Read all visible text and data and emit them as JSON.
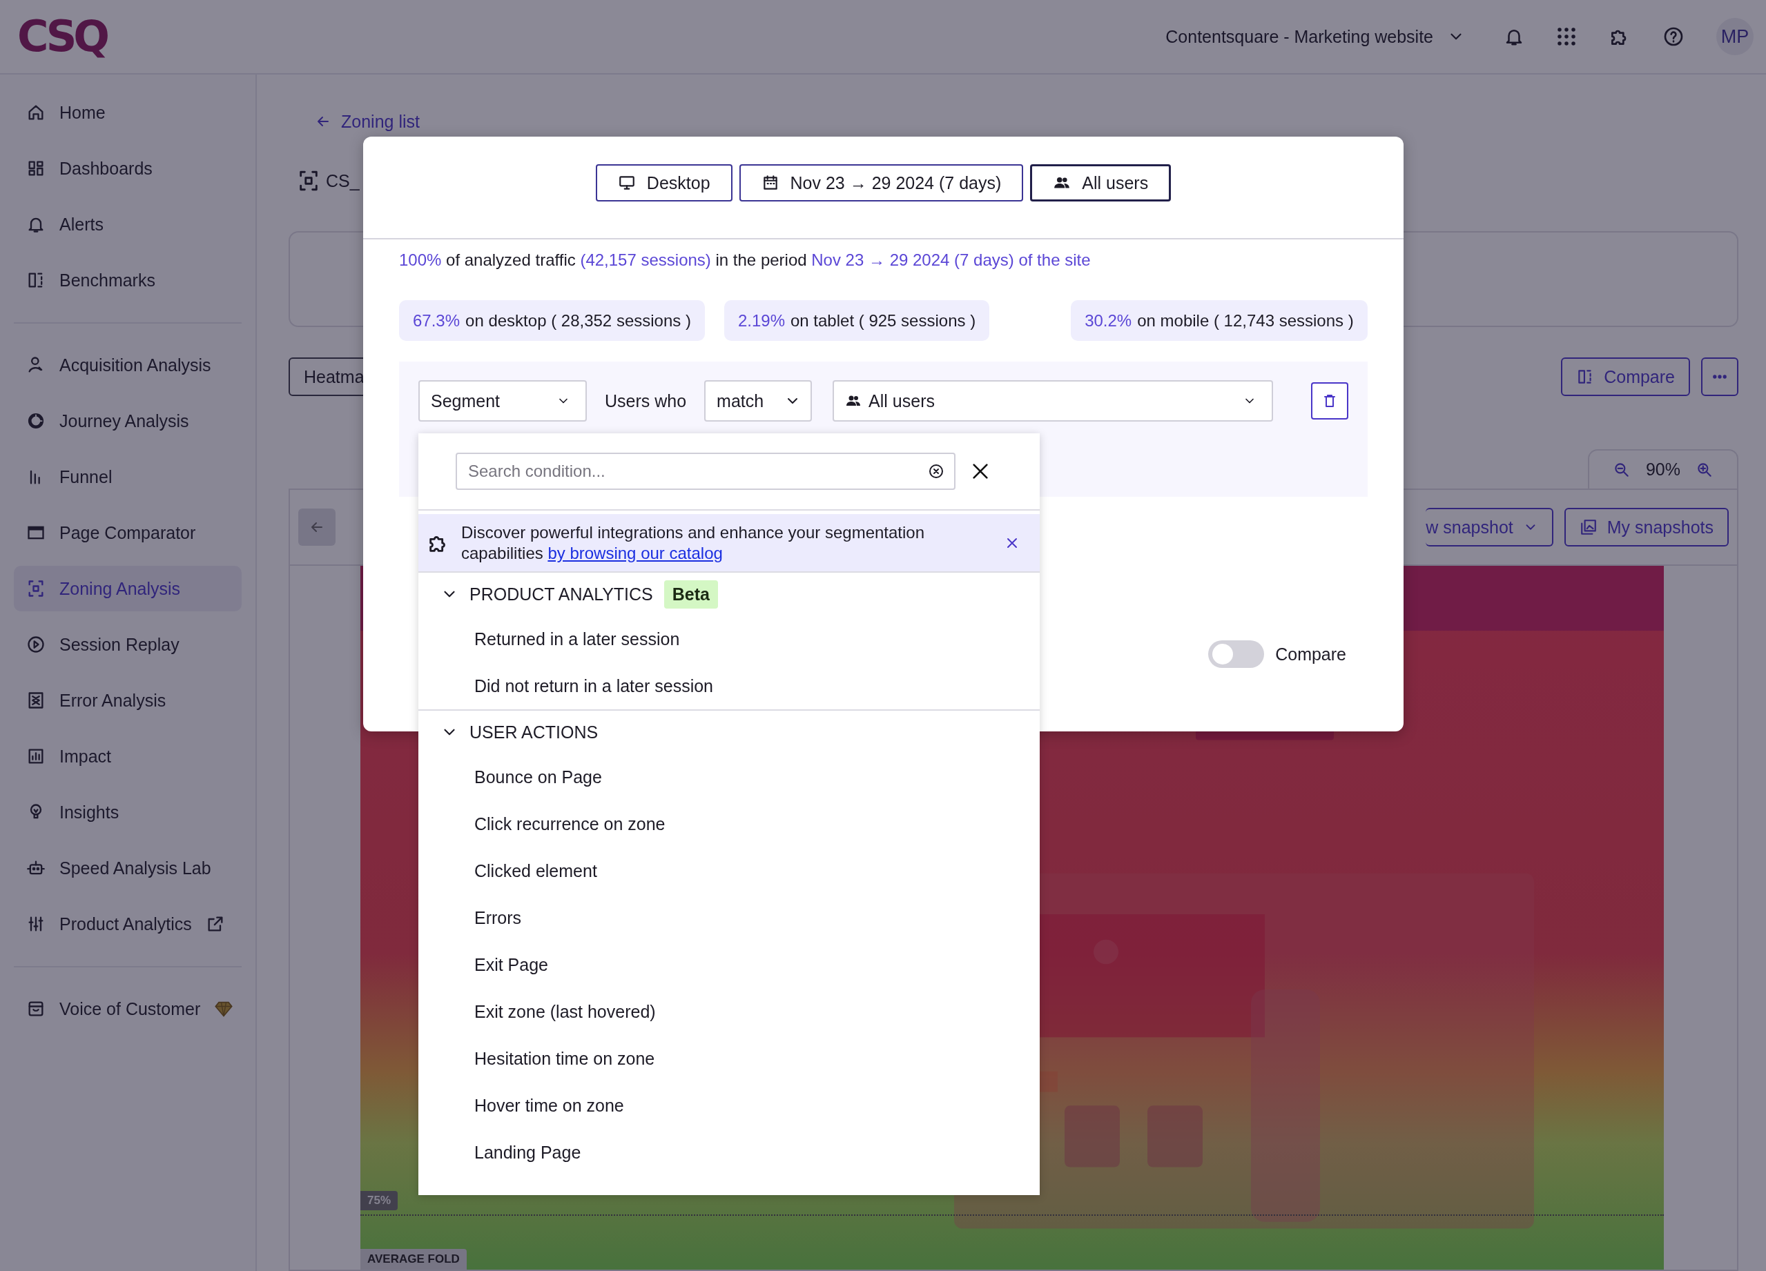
{
  "header": {
    "logo": "CSQ",
    "project": "Contentsquare - Marketing website",
    "avatar": "MP"
  },
  "sidebar": {
    "groups": [
      {
        "items": [
          {
            "label": "Home",
            "selected": false
          },
          {
            "label": "Dashboards",
            "selected": false
          },
          {
            "label": "Alerts",
            "selected": false
          },
          {
            "label": "Benchmarks",
            "selected": false
          }
        ]
      },
      {
        "items": [
          {
            "label": "Acquisition Analysis",
            "selected": false
          },
          {
            "label": "Journey Analysis",
            "selected": false
          },
          {
            "label": "Funnel",
            "selected": false
          },
          {
            "label": "Page Comparator",
            "selected": false
          },
          {
            "label": "Zoning Analysis",
            "selected": true
          },
          {
            "label": "Session Replay",
            "selected": false
          },
          {
            "label": "Error Analysis",
            "selected": false
          },
          {
            "label": "Impact",
            "selected": false
          },
          {
            "label": "Insights",
            "selected": false
          },
          {
            "label": "Speed Analysis Lab",
            "selected": false
          },
          {
            "label": "Product Analytics",
            "selected": false
          }
        ]
      },
      {
        "items": [
          {
            "label": "Voice of Customer",
            "selected": false
          }
        ]
      }
    ]
  },
  "main": {
    "back_link": "Zoning list",
    "title": "CS_",
    "view_button": "Heatma",
    "compare_button": "Compare",
    "zoom": "90%",
    "snapshot_dropdown": "w snapshot",
    "snapshots_button": "My snapshots",
    "fold_percent": "75%",
    "fold_label": "AVERAGE FOLD"
  },
  "modal": {
    "filters": [
      "Desktop",
      "Nov 23 → 29 2024 (7 days)",
      "All users"
    ],
    "summary": [
      {
        "text": "100%",
        "highlight": true
      },
      {
        "text": " of analyzed traffic ",
        "highlight": false
      },
      {
        "text": "(42,157 sessions)",
        "highlight": true
      },
      {
        "text": " in the period ",
        "highlight": false
      },
      {
        "text": "Nov 23 → 29 2024 (7 days) of the site",
        "highlight": true
      }
    ],
    "stats": [
      {
        "percent": "67.3%",
        "label": "on desktop ( 28,352 sessions )"
      },
      {
        "percent": "2.19%",
        "label": "on tablet ( 925 sessions )"
      },
      {
        "percent": "30.2%",
        "label": "on mobile ( 12,743 sessions )"
      }
    ],
    "segment": {
      "type": "Segment",
      "users_who": "Users who",
      "operator": "match",
      "value": "All users"
    },
    "compare": {
      "label": "Compare",
      "on": false
    }
  },
  "dropdown": {
    "search_placeholder": "Search condition...",
    "banner": {
      "text": "Discover powerful integrations and enhance your segmentation capabilities ",
      "link": "by browsing our catalog"
    },
    "groups": [
      {
        "title": "PRODUCT ANALYTICS",
        "badge": "Beta",
        "expanded": true,
        "items": [
          "Returned in a later session",
          "Did not return in a later session"
        ]
      },
      {
        "title": "USER ACTIONS",
        "expanded": true,
        "items": [
          "Bounce on Page",
          "Click recurrence on zone",
          "Clicked element",
          "Errors",
          "Exit Page",
          "Exit zone (last hovered)",
          "Hesitation time on zone",
          "Hover time on zone",
          "Landing Page"
        ]
      }
    ]
  }
}
